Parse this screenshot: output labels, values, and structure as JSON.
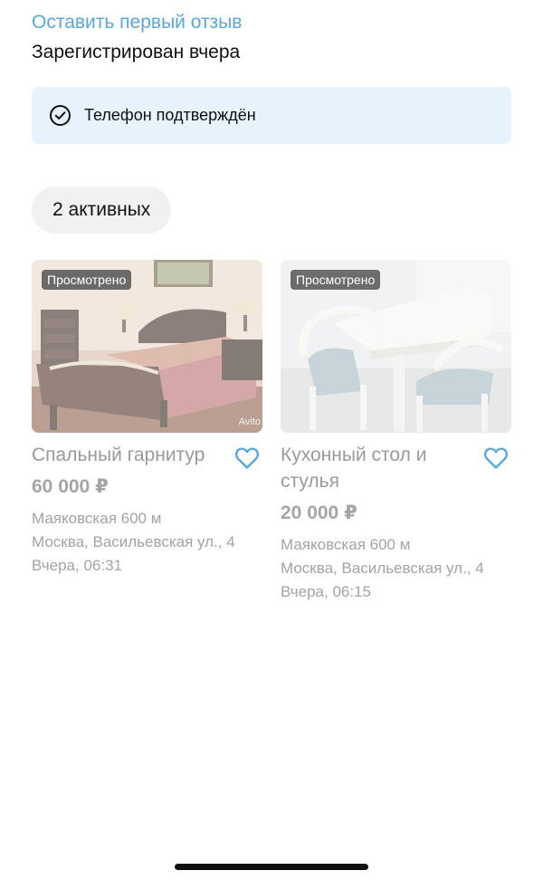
{
  "profile": {
    "review_link": "Оставить первый отзыв",
    "registered": "Зарегистрирован вчера",
    "verification": {
      "text": "Телефон подтверждён",
      "icon": "check-circle-icon"
    }
  },
  "active_chip": "2 активных",
  "listings": [
    {
      "badge": "Просмотрено",
      "watermark": "Avito",
      "title": "Спальный гарнитур",
      "price": "60 000 ₽",
      "metro": "Маяковская 600 м",
      "address": "Москва, Васильевская ул., 4",
      "date": "Вчера, 06:31",
      "icon": "heart-icon"
    },
    {
      "badge": "Просмотрено",
      "title": "Кухонный стол и стулья",
      "price": "20 000 ₽",
      "metro": "Маяковская 600 м",
      "address": "Москва, Васильевская ул., 4",
      "date": "Вчера, 06:15",
      "icon": "heart-icon"
    }
  ],
  "colors": {
    "accent": "#57a7e0",
    "verify_bg": "#e6f3fc",
    "chip_bg": "#f1f1f1",
    "muted_text": "#a3a3a3"
  }
}
